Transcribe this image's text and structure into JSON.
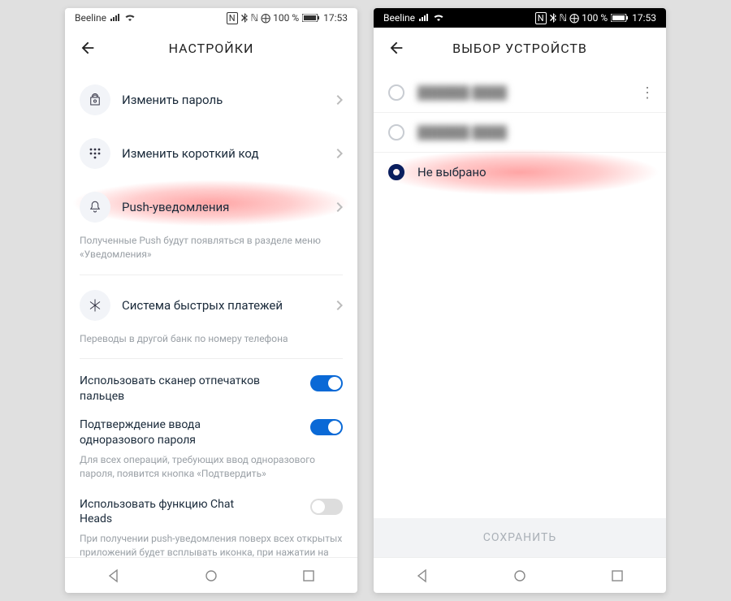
{
  "status": {
    "carrier": "Beeline",
    "indicators": "ℕ ⨁ 100 %",
    "time": "17:53"
  },
  "left": {
    "title": "НАСТРОЙКИ",
    "items": {
      "change_password": "Изменить пароль",
      "change_short_code": "Изменить короткий код",
      "push": "Push-уведомления",
      "push_sub": "Полученные Push будут появляться в разделе меню «Уведомления»",
      "sbp": "Система быстрых платежей",
      "sbp_sub": "Переводы в другой банк по номеру телефона"
    },
    "toggles": {
      "fingerprint": "Использовать сканер отпечатков пальцев",
      "otp_confirm": "Подтверждение ввода одноразового пароля",
      "otp_sub": "Для всех операций, требующих ввод одноразового пароля, появится кнопка «Подтвердить»",
      "chat_heads": "Использовать функцию Chat Heads",
      "chat_heads_sub": "При получении push-уведомления поверх всех открытых приложений будет всплывать иконка, при нажатии на которую можно посмотреть недавние push-уведомления"
    }
  },
  "right": {
    "title": "ВЫБОР УСТРОЙСТВ",
    "device1": "██████ ████",
    "device2": "██████ ████",
    "none": "Не выбрано",
    "save": "СОХРАНИТЬ"
  }
}
